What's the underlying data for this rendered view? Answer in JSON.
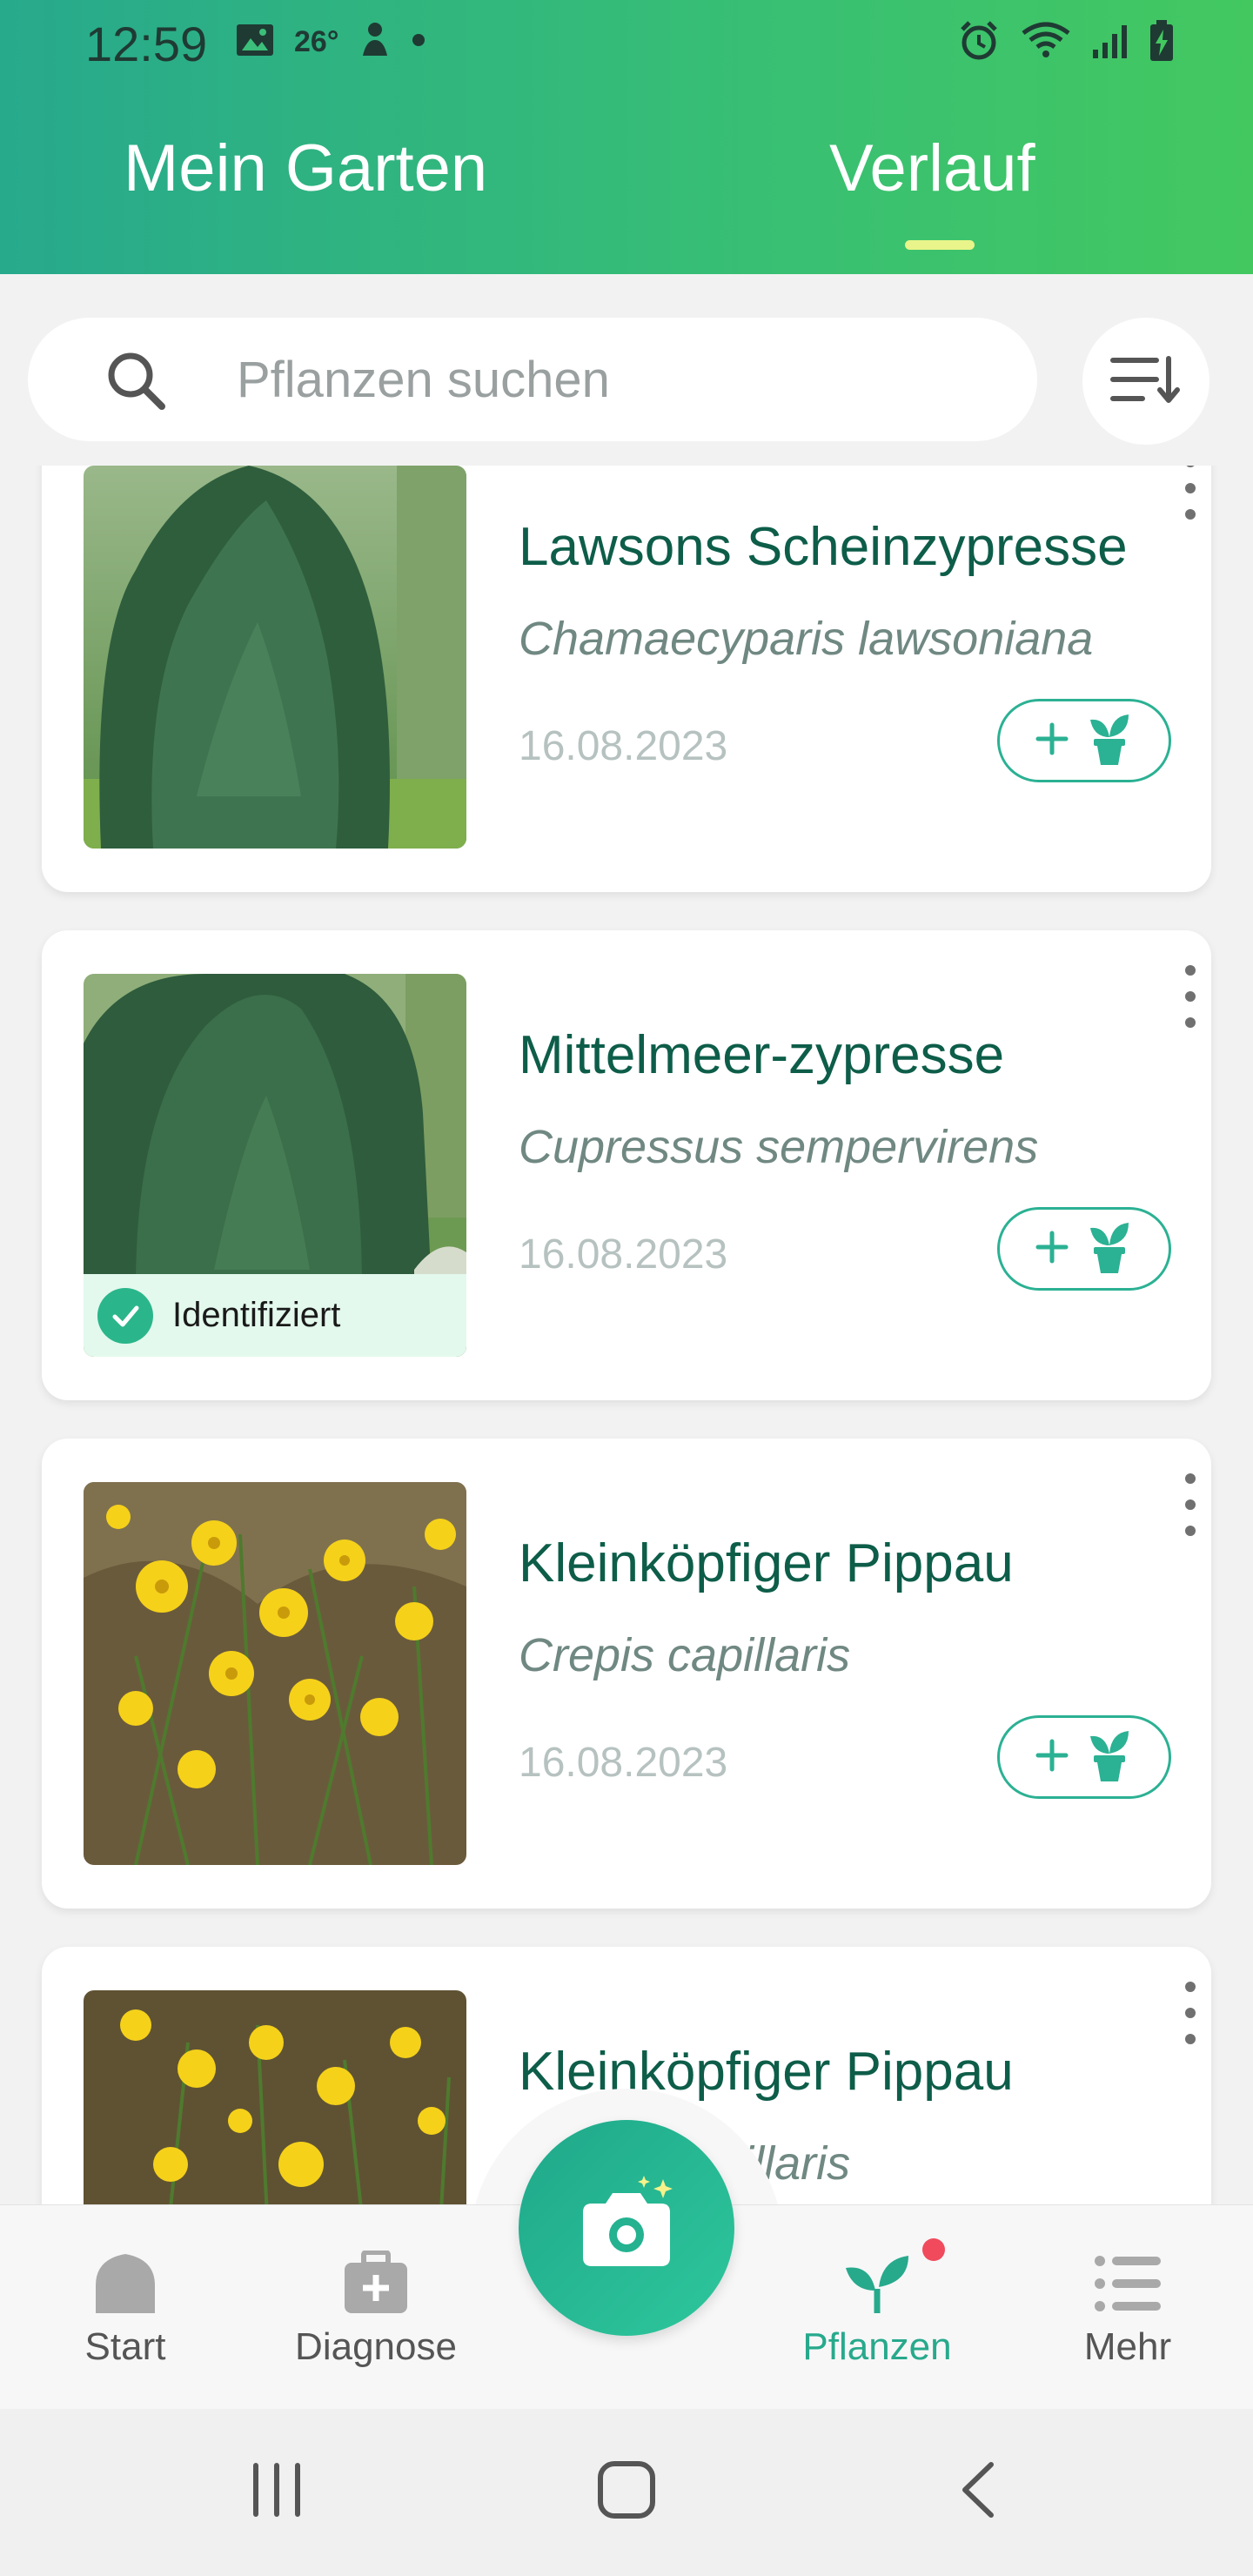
{
  "status_bar": {
    "time": "12:59",
    "temperature": "26°",
    "icons": [
      "image-icon",
      "weather-icon",
      "notification-dot",
      "alarm-icon",
      "wifi-icon",
      "signal-icon",
      "battery-icon"
    ]
  },
  "header": {
    "tabs": [
      {
        "label": "Mein Garten",
        "active": false
      },
      {
        "label": "Verlauf",
        "active": true
      }
    ],
    "indicator_color": "#e9f58a"
  },
  "search": {
    "placeholder": "Pflanzen suchen",
    "value": ""
  },
  "plants": [
    {
      "common_name": "Lawsons Scheinzypresse",
      "scientific_name": "Chamaecyparis lawsoniana",
      "date": "16.08.2023",
      "badge": "",
      "photo": "conifer"
    },
    {
      "common_name": "Mittelmeer-zypresse",
      "scientific_name": "Cupressus sempervirens",
      "date": "16.08.2023",
      "badge": "Identifiziert",
      "photo": "conifer"
    },
    {
      "common_name": "Kleinköpfiger Pippau",
      "scientific_name": "Crepis capillaris",
      "date": "16.08.2023",
      "badge": "",
      "photo": "yellow-flowers"
    },
    {
      "common_name": "Kleinköpfiger Pippau",
      "scientific_name": "Crepis capillaris",
      "date": "",
      "badge": "",
      "photo": "yellow-flowers"
    }
  ],
  "bottom_nav": {
    "items": [
      {
        "label": "Start",
        "icon": "home-icon",
        "active": false
      },
      {
        "label": "Diagnose",
        "icon": "medical-kit-icon",
        "active": false
      },
      {
        "label": "Pflanzen",
        "icon": "sprout-icon",
        "active": true
      },
      {
        "label": "Mehr",
        "icon": "menu-list-icon",
        "active": false
      }
    ],
    "camera_icon": "camera-icon"
  },
  "colors": {
    "accent": "#27a98c",
    "title_green": "#0d5d49",
    "badge_red": "#f04a5c"
  }
}
